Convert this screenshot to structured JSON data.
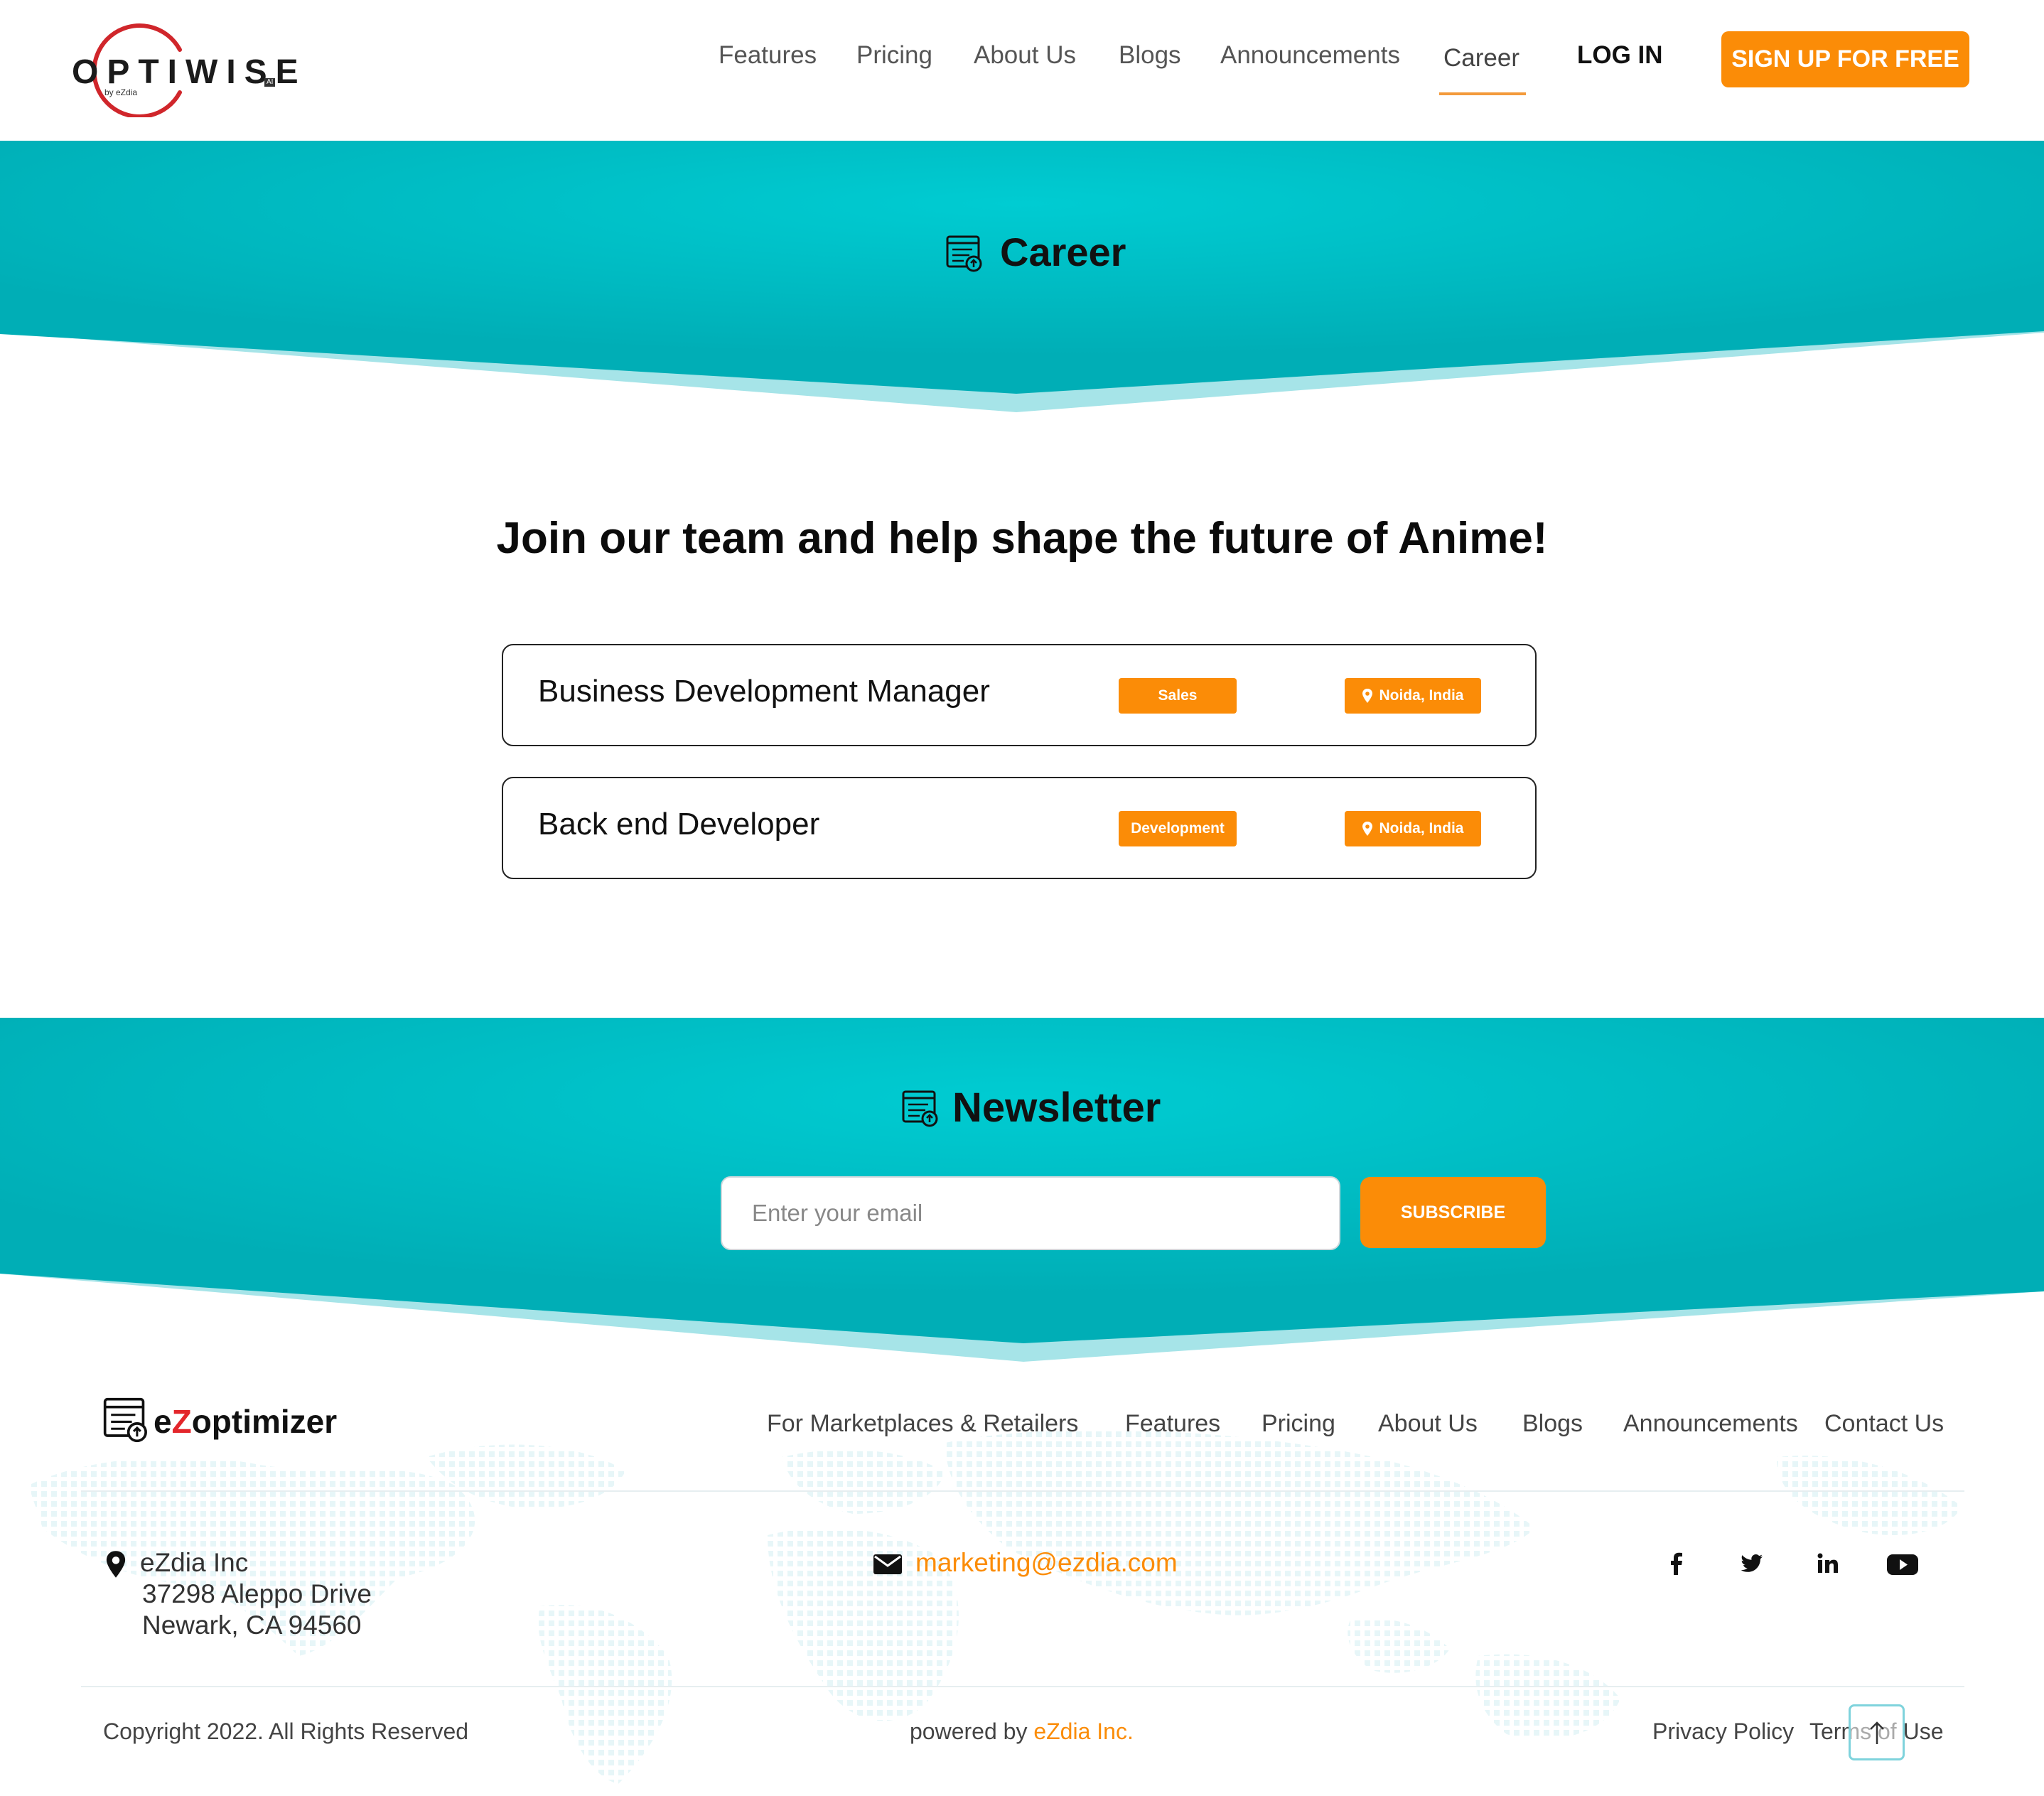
{
  "header": {
    "logo_text": "OPTIWISE",
    "logo_sub": "by eZdia",
    "logo_badge": "AI",
    "nav": [
      "Features",
      "Pricing",
      "About Us",
      "Blogs",
      "Announcements",
      "Career"
    ],
    "active_nav": "Career",
    "login_label": "LOG IN",
    "signup_label": "SIGN UP FOR FREE"
  },
  "hero": {
    "title": "Career",
    "icon": "optimizer-list-icon"
  },
  "jobs": {
    "heading": "Join our team and help shape the future of Anime!",
    "items": [
      {
        "title": "Business Development Manager",
        "department": "Sales",
        "location": "Noida, India"
      },
      {
        "title": "Back end Developer",
        "department": "Development",
        "location": "Noida, India"
      }
    ]
  },
  "newsletter": {
    "title": "Newsletter",
    "email_placeholder": "Enter your email",
    "subscribe_label": "SUBSCRIBE"
  },
  "footer": {
    "brand_prefix": "e",
    "brand_z": "Z",
    "brand_suffix": "optimizer",
    "links": [
      "For Marketplaces & Retailers",
      "Features",
      "Pricing",
      "About Us",
      "Blogs",
      "Announcements",
      "Contact Us"
    ],
    "address": [
      "eZdia Inc",
      "37298 Aleppo Drive",
      "Newark, CA 94560"
    ],
    "email": "marketing@ezdia.com",
    "social": [
      "facebook-icon",
      "twitter-icon",
      "linkedin-icon",
      "youtube-icon"
    ],
    "copyright": "Copyright 2022. All Rights Reserved",
    "powered_prefix": "powered by ",
    "powered_link": "eZdia Inc.",
    "privacy": "Privacy Policy",
    "terms": "Terms of Use"
  },
  "colors": {
    "accent": "#fb8c07",
    "teal": "#00c1c9",
    "teal_dark": "#00aeb6",
    "logo_ring": "#d0262b"
  }
}
